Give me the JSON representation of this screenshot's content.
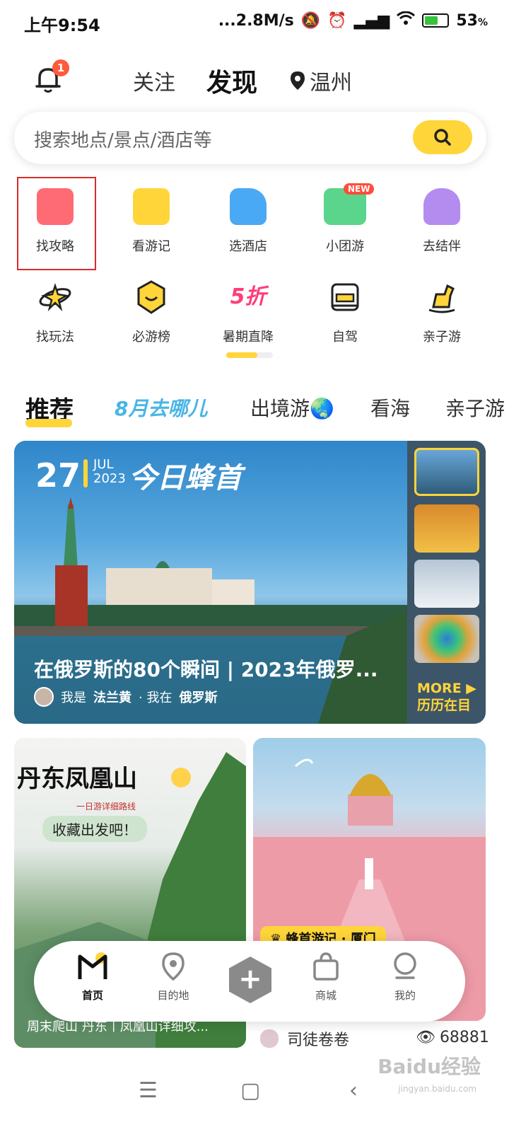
{
  "status_bar": {
    "time": "上午9:54",
    "network": "...2.8M/s",
    "battery": "53"
  },
  "header": {
    "bell_badge": "1",
    "tabs": {
      "follow": "关注",
      "discover": "发现"
    },
    "location": "温州"
  },
  "search": {
    "placeholder": "搜索地点/景点/酒店等"
  },
  "shortcuts": {
    "row1": [
      {
        "label": "找攻略",
        "color": "#ff6b74"
      },
      {
        "label": "看游记",
        "color": "#ffd53a"
      },
      {
        "label": "选酒店",
        "color": "#4aa9f5"
      },
      {
        "label": "小团游",
        "color": "#5bd48c",
        "badge": "NEW"
      },
      {
        "label": "去结伴",
        "color": "#b48cf0"
      }
    ],
    "row2": [
      {
        "label": "找玩法"
      },
      {
        "label": "必游榜"
      },
      {
        "label": "暑期直降",
        "badge_text": "5折"
      },
      {
        "label": "自驾"
      },
      {
        "label": "亲子游"
      }
    ]
  },
  "categories": [
    "推荐",
    "8月去哪儿",
    "出境游",
    "看海",
    "亲子游"
  ],
  "featured": {
    "day": "27",
    "month": "JUL",
    "year": "2023",
    "banner": "今日蜂首",
    "title": "在俄罗斯的80个瞬间 | 2023年俄罗...",
    "author_prefix": "我是",
    "author": "法兰黄",
    "location_prefix": "· 我在",
    "location": "俄罗斯",
    "more": "MORE",
    "more_sub": "历历在目"
  },
  "feed": {
    "left": {
      "title": "丹东凤凰山",
      "sub": "一日游详细路线",
      "sub2": "收藏出发吧！",
      "caption": "周末爬山 丹东丨凤凰山详细攻..."
    },
    "right": {
      "tag": "蜂首游记 · 厦门",
      "author": "司徒卷卷",
      "views": "68881"
    }
  },
  "bottom_nav": [
    {
      "label": "首页"
    },
    {
      "label": "目的地"
    },
    {
      "label": "商城"
    },
    {
      "label": "我的"
    }
  ],
  "watermark": {
    "main": "Baidu经验",
    "sub": "jingyan.baidu.com"
  }
}
